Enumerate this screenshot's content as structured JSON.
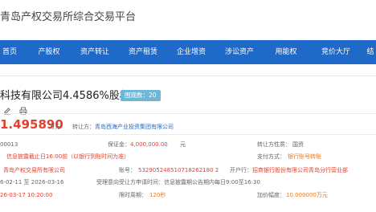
{
  "header": {
    "site_title": "青岛产权交易所综合交易平台"
  },
  "nav": {
    "items": [
      "首页",
      "产股权",
      "资产转让",
      "资产租赁",
      "企业增资",
      "涉讼资产",
      "用能权",
      "竞价大厅",
      "结"
    ]
  },
  "project": {
    "title": "科技有限公司4.4586%股权",
    "badge": "围观数：20"
  },
  "listing": {
    "price": "1.495890",
    "price_unit": "万元",
    "transferor_label": "转让方：",
    "transferor": "青岛西海产业投资集团有限公司",
    "code": "00013",
    "deposit_label": "保证金：",
    "deposit": "4,000,000.00",
    "deposit_unit": "元",
    "nature_label": "转让方性质：",
    "nature": "国资",
    "disclosure_deadline": "信息披露截止日16:00前（以银行到账时间为准）",
    "payment_label": "支付方式：",
    "payment": "银行账号转账",
    "bank_name": "青岛产权交易所有限公司",
    "account_label": "账号：",
    "account": "532905248510718262180 2",
    "bank_label": "开户行：",
    "bank": "招商银行股份有限公司青岛分行营业部",
    "date_range": "6-02-11 至 2026-03-16",
    "reg_note": "受理意向受让方申请时间：信息披露期公告期内每日9:00至16:30",
    "bid_start": "26-03-17 10:20:00",
    "period_label": "限时周期：",
    "period": "120秒",
    "increment_label": "加价幅度：",
    "increment": "10.000000万元"
  }
}
